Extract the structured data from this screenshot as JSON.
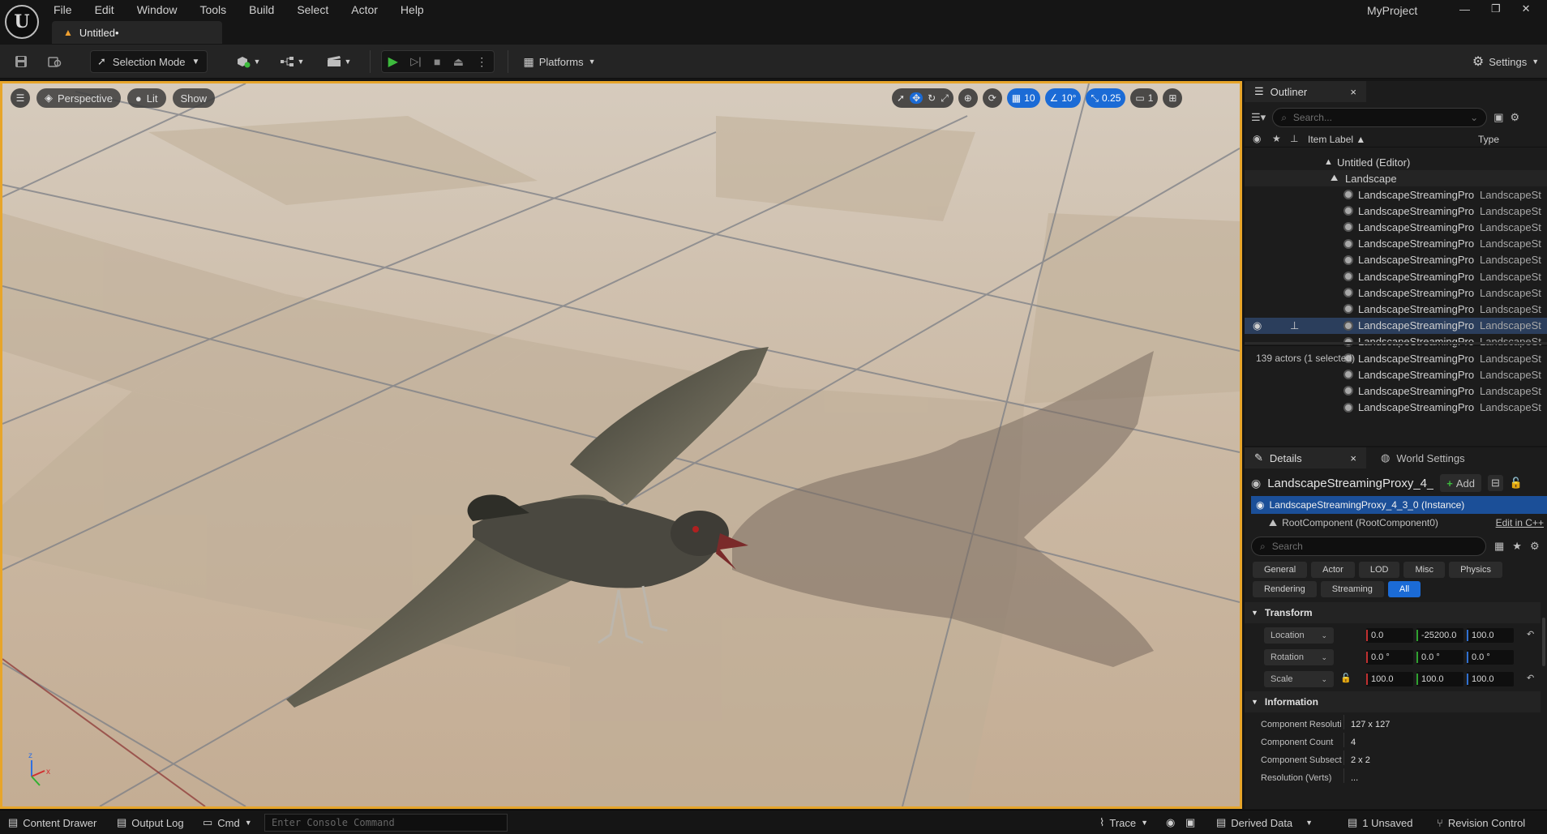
{
  "app": {
    "logo": "U",
    "project_name": "MyProject",
    "menu": [
      "File",
      "Edit",
      "Window",
      "Tools",
      "Build",
      "Select",
      "Actor",
      "Help"
    ],
    "doc_tab": "Untitled•",
    "win_controls": [
      "—",
      "❐",
      "✕"
    ]
  },
  "toolbar": {
    "selection_mode": "Selection Mode",
    "platforms": "Platforms",
    "settings": "Settings"
  },
  "viewport": {
    "perspective": "Perspective",
    "lit": "Lit",
    "show": "Show",
    "grid_snap": "10",
    "rot_snap": "10°",
    "scale_snap": "0.25",
    "camera_speed": "1"
  },
  "outliner": {
    "tab": "Outliner",
    "search_placeholder": "Search...",
    "col_label": "Item Label ▲",
    "col_type": "Type",
    "world": "Untitled (Editor)",
    "landscape": "Landscape",
    "rows": [
      {
        "label": "LandscapeStreamingPro",
        "type": "LandscapeSt"
      },
      {
        "label": "LandscapeStreamingPro",
        "type": "LandscapeSt"
      },
      {
        "label": "LandscapeStreamingPro",
        "type": "LandscapeSt"
      },
      {
        "label": "LandscapeStreamingPro",
        "type": "LandscapeSt"
      },
      {
        "label": "LandscapeStreamingPro",
        "type": "LandscapeSt"
      },
      {
        "label": "LandscapeStreamingPro",
        "type": "LandscapeSt"
      },
      {
        "label": "LandscapeStreamingPro",
        "type": "LandscapeSt"
      },
      {
        "label": "LandscapeStreamingPro",
        "type": "LandscapeSt"
      },
      {
        "label": "LandscapeStreamingPro",
        "type": "LandscapeSt",
        "selected": true
      },
      {
        "label": "LandscapeStreamingPro",
        "type": "LandscapeSt"
      },
      {
        "label": "LandscapeStreamingPro",
        "type": "LandscapeSt"
      },
      {
        "label": "LandscapeStreamingPro",
        "type": "LandscapeSt"
      },
      {
        "label": "LandscapeStreamingPro",
        "type": "LandscapeSt"
      },
      {
        "label": "LandscapeStreamingPro",
        "type": "LandscapeSt"
      }
    ],
    "footer": "139 actors (1 selected)"
  },
  "details": {
    "tab": "Details",
    "world_settings_tab": "World Settings",
    "actor_name": "LandscapeStreamingProxy_4_",
    "add_button": "Add",
    "instance": "LandscapeStreamingProxy_4_3_0 (Instance)",
    "root_component": "RootComponent (RootComponent0)",
    "edit_cpp": "Edit in C++",
    "search_placeholder": "Search",
    "categories_row1": [
      "General",
      "Actor",
      "LOD",
      "Misc",
      "Physics"
    ],
    "categories_row2": [
      "Rendering",
      "Streaming",
      "All"
    ],
    "transform_header": "Transform",
    "location_label": "Location",
    "rotation_label": "Rotation",
    "scale_label": "Scale",
    "location": [
      "0.0",
      "-25200.0",
      "100.0"
    ],
    "rotation": [
      "0.0 °",
      "0.0 °",
      "0.0 °"
    ],
    "scale": [
      "100.0",
      "100.0",
      "100.0"
    ],
    "information_header": "Information",
    "info": [
      {
        "label": "Component Resolution (",
        "value": "127 x 127"
      },
      {
        "label": "Component Count",
        "value": "4"
      },
      {
        "label": "Component Subsections",
        "value": "2 x 2"
      },
      {
        "label": "Resolution (Verts)",
        "value": "..."
      }
    ]
  },
  "statusbar": {
    "content_drawer": "Content Drawer",
    "output_log": "Output Log",
    "cmd": "Cmd",
    "console_placeholder": "Enter Console Command",
    "trace": "Trace",
    "derived_data": "Derived Data",
    "unsaved": "1 Unsaved",
    "revision_control": "Revision Control"
  },
  "colors": {
    "accent": "#e7a52a",
    "selection_blue": "#1b6bd6",
    "play_green": "#3dbb3d"
  }
}
